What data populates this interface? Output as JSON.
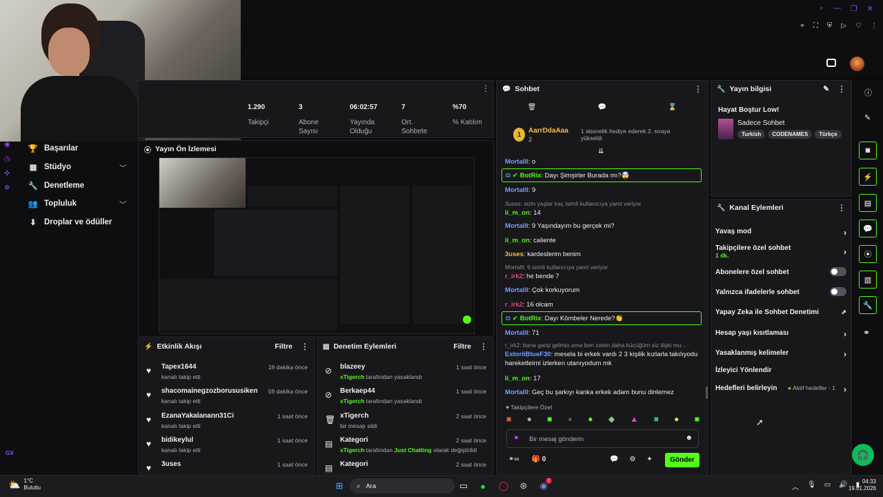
{
  "stats": [
    {
      "value": "1.290",
      "label": "Takipçi"
    },
    {
      "value": "3",
      "label": "Abone Sayısı"
    },
    {
      "value": "06:02:57",
      "label": "Yayında Olduğu"
    },
    {
      "value": "7",
      "label": "Ort. Sohbete"
    },
    {
      "value": "%70",
      "label": "% Katılım"
    }
  ],
  "nav": {
    "items": [
      {
        "label": "Başarılar"
      },
      {
        "label": "Stüdyo"
      },
      {
        "label": "Denetleme"
      },
      {
        "label": "Topluluk"
      },
      {
        "label": "Droplar ve ödüller"
      }
    ],
    "gx": "GX"
  },
  "preview": {
    "title": "Yayın Ön İzlemesi"
  },
  "activity": {
    "title": "Etkinlik Akışı",
    "filter": "Filtre",
    "items": [
      {
        "name": "Tapex1644",
        "sub": "kanalı takip etti",
        "time": "19 dakika önce"
      },
      {
        "name": "shacomainegzozborususiken",
        "sub": "kanalı takip etti",
        "time": "59 dakika önce"
      },
      {
        "name": "EzanaYakalanann31Ci",
        "sub": "kanalı takip etti",
        "time": "1 saat önce"
      },
      {
        "name": "bidikeylul",
        "sub": "kanalı takip etti",
        "time": "1 saat önce"
      },
      {
        "name": "3uses",
        "sub": "",
        "time": "1 saat önce"
      }
    ]
  },
  "moderation": {
    "title": "Denetim Eylemleri",
    "filter": "Filtre",
    "items": [
      {
        "name": "blazeey",
        "actor": "xTigerch",
        "text": " tarafından yasaklandı",
        "extra": "",
        "extra2": "",
        "time": "1 saat önce"
      },
      {
        "name": "Berkaep44",
        "actor": "xTigerch",
        "text": " tarafından yasaklandı",
        "extra": "",
        "extra2": "",
        "time": "1 saat önce"
      },
      {
        "name": "xTigerch",
        "actor": "",
        "text": "bir mesajı sildi",
        "extra": "",
        "extra2": "",
        "time": "2 saat önce"
      },
      {
        "name": "Kategori",
        "actor": "xTigerch",
        "text": " tarafından ",
        "extra": "Just Chatting",
        "extra2": " olarak değiştirildi",
        "time": "2 saat önce"
      },
      {
        "name": "Kategori",
        "actor": "",
        "text": "",
        "extra": "",
        "extra2": "",
        "time": "2 saat önce"
      }
    ]
  },
  "chat": {
    "title": "Sohbet",
    "pinned": {
      "user": "AarrDdaAaa",
      "count": "2",
      "badge": "1",
      "text": "1 abonelik hediye ederek 2. sıraya yükseldi"
    },
    "messages": [
      {
        "user": "Mortalll",
        "text": ": o"
      },
      {
        "user": "BotRix",
        "text": ": Dayı Şimşirler Burada mı?🤯"
      },
      {
        "user": "Mortalll",
        "text": ": 9"
      },
      {
        "reply": "3uses: sizin yaşlar kaç isimli kullanıcıya yanıt veriyor",
        "user": "li_m_on",
        "text": ": 14"
      },
      {
        "user": "Mortalll",
        "text": ": 9 Yaşındayım bu gerçek mi?"
      },
      {
        "user": "li_m_on",
        "text": ": caliente"
      },
      {
        "user": "3uses",
        "text": ": kardeslerim benim"
      },
      {
        "reply": "Mortalll: 9 isimli kullanıcıya yanıt veriyor",
        "user": "r_irk2",
        "text": ": he bende 7"
      },
      {
        "user": "Mortalll",
        "text": ": Çok korkuyorum"
      },
      {
        "user": "r_irk2",
        "text": ": 16 olcam"
      },
      {
        "user": "BotRix",
        "text": ": Dayı Kömbeler Nerede?👏"
      },
      {
        "user": "Mortalll",
        "text": ": 71"
      },
      {
        "reply": "r_irk2: bana garip gelmio ama ben zaten daha küçüğüm siz ilişki mu...",
        "user": "EstoriiBlueF30",
        "text": ": mesela bi erkek vardı 2 3 kişilik kızlarla takılıyodu hareketleirni izlerken utanıyodum mk"
      },
      {
        "user": "li_m_on",
        "text": ": 17"
      },
      {
        "user": "Mortalll",
        "text": ": Geç bu şarkıyı kanka erkek adam bunu dinlemez"
      }
    ],
    "emote_section": "Takipçilere Özel",
    "input_placeholder": "Bir mesaj gönderin",
    "bottom_count": "0",
    "send_label": "Gönder"
  },
  "stream_info": {
    "title": "Yayın bilgisi",
    "stream_title": "Hayat Boştur Low!",
    "category": "Sadece Sohbet",
    "tags": [
      "Turkish",
      "CODENAMES",
      "Türkçe"
    ]
  },
  "channel_actions": {
    "title": "Kanal Eylemleri",
    "items": [
      {
        "label": "Yavaş mod"
      },
      {
        "label": "Takipçilere özel sohbet",
        "sub": "1 dk."
      },
      {
        "label": "Abonelere özel sohbet"
      },
      {
        "label": "Yalnızca ifadelerle sohbet"
      },
      {
        "label": "Yapay Zeka ile Sohbet Denetimi"
      },
      {
        "label": "Hesap yaşı kısıtlaması"
      },
      {
        "label": "Yasaklanmış kelimeler"
      },
      {
        "label": "İzleyici Yönlendir"
      },
      {
        "label": "Hedefleri belirleyin",
        "status": "Aktif hedefler - 1"
      }
    ]
  },
  "taskbar": {
    "weather_temp": "1°C",
    "weather_desc": "Bulutlu",
    "search": "Ara",
    "time": "04:33",
    "date": "19.01.2026",
    "badge": "2"
  },
  "colors": {
    "accent": "#53fc18",
    "panel": "#18181b",
    "bg": "#0b0b0d"
  }
}
